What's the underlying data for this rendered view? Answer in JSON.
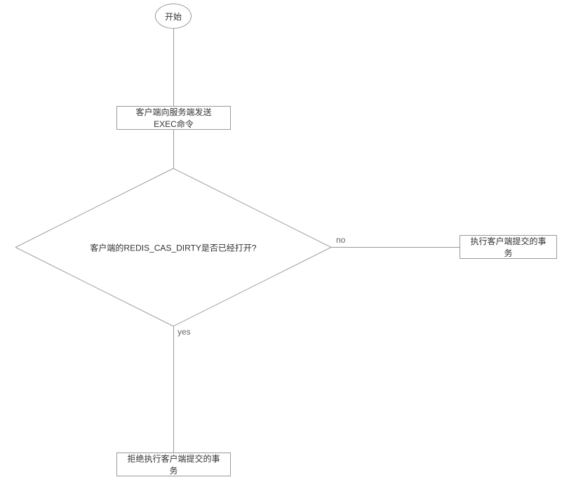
{
  "flowchart": {
    "start": "开始",
    "step_send_exec": "客户端向服务端发送EXEC命令",
    "decision": "客户端的REDIS_CAS_DIRTY是否已经打开?",
    "label_yes": "yes",
    "label_no": "no",
    "result_reject": "拒绝执行客户端提交的事务",
    "result_execute": "执行客户端提交的事务"
  },
  "chart_data": {
    "type": "flowchart",
    "nodes": [
      {
        "id": "start",
        "type": "terminator",
        "label": "开始"
      },
      {
        "id": "send_exec",
        "type": "process",
        "label": "客户端向服务端发送EXEC命令"
      },
      {
        "id": "check_dirty",
        "type": "decision",
        "label": "客户端的REDIS_CAS_DIRTY是否已经打开?"
      },
      {
        "id": "reject",
        "type": "process",
        "label": "拒绝执行客户端提交的事务"
      },
      {
        "id": "execute",
        "type": "process",
        "label": "执行客户端提交的事务"
      }
    ],
    "edges": [
      {
        "from": "start",
        "to": "send_exec",
        "label": ""
      },
      {
        "from": "send_exec",
        "to": "check_dirty",
        "label": ""
      },
      {
        "from": "check_dirty",
        "to": "reject",
        "label": "yes"
      },
      {
        "from": "check_dirty",
        "to": "execute",
        "label": "no"
      }
    ]
  }
}
